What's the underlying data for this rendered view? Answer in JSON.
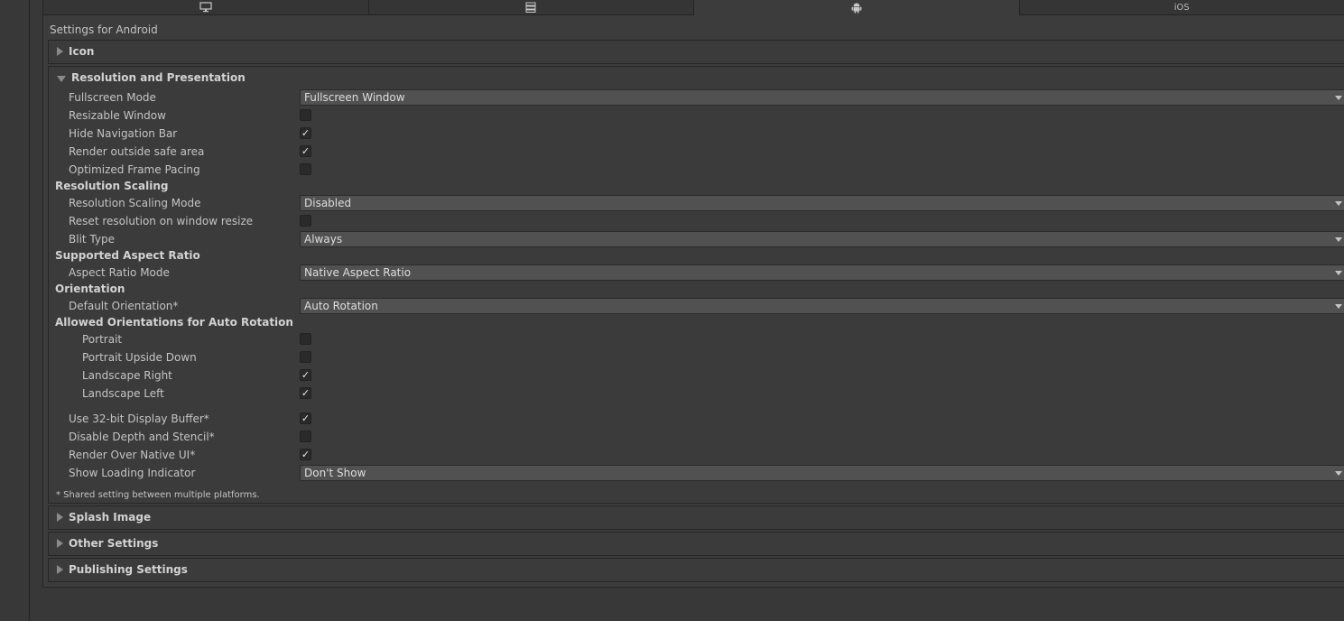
{
  "tabs": [
    {
      "label": "",
      "icon": "monitor-icon"
    },
    {
      "label": "",
      "icon": "server-icon"
    },
    {
      "label": "",
      "icon": "android-icon"
    },
    {
      "label": "iOS",
      "icon": ""
    }
  ],
  "title": "Settings for Android",
  "sections": {
    "icon": "Icon",
    "resolution": "Resolution and Presentation",
    "splash": "Splash Image",
    "other": "Other Settings",
    "publishing": "Publishing Settings"
  },
  "fields": {
    "fullscreen_mode": {
      "label": "Fullscreen Mode",
      "value": "Fullscreen Window"
    },
    "resizable_window": {
      "label": "Resizable Window",
      "checked": false
    },
    "hide_navigation_bar": {
      "label": "Hide Navigation Bar",
      "checked": true
    },
    "render_outside_safe_area": {
      "label": "Render outside safe area",
      "checked": true
    },
    "optimized_frame_pacing": {
      "label": "Optimized Frame Pacing",
      "checked": false
    },
    "resolution_scaling_header": "Resolution Scaling",
    "resolution_scaling_mode": {
      "label": "Resolution Scaling Mode",
      "value": "Disabled"
    },
    "reset_resolution": {
      "label": "Reset resolution on window resize",
      "checked": false
    },
    "blit_type": {
      "label": "Blit Type",
      "value": "Always"
    },
    "supported_aspect_header": "Supported Aspect Ratio",
    "aspect_ratio_mode": {
      "label": "Aspect Ratio Mode",
      "value": "Native Aspect Ratio"
    },
    "orientation_header": "Orientation",
    "default_orientation": {
      "label": "Default Orientation*",
      "value": "Auto Rotation"
    },
    "allowed_orientations_header": "Allowed Orientations for Auto Rotation",
    "portrait": {
      "label": "Portrait",
      "checked": false
    },
    "portrait_upside_down": {
      "label": "Portrait Upside Down",
      "checked": false
    },
    "landscape_right": {
      "label": "Landscape Right",
      "checked": true
    },
    "landscape_left": {
      "label": "Landscape Left",
      "checked": true
    },
    "use_32bit_buffer": {
      "label": "Use 32-bit Display Buffer*",
      "checked": true
    },
    "disable_depth_stencil": {
      "label": "Disable Depth and Stencil*",
      "checked": false
    },
    "render_over_native_ui": {
      "label": "Render Over Native UI*",
      "checked": true
    },
    "show_loading_indicator": {
      "label": "Show Loading Indicator",
      "value": "Don't Show"
    }
  },
  "footnote": "* Shared setting between multiple platforms.",
  "check_glyph": "✓"
}
